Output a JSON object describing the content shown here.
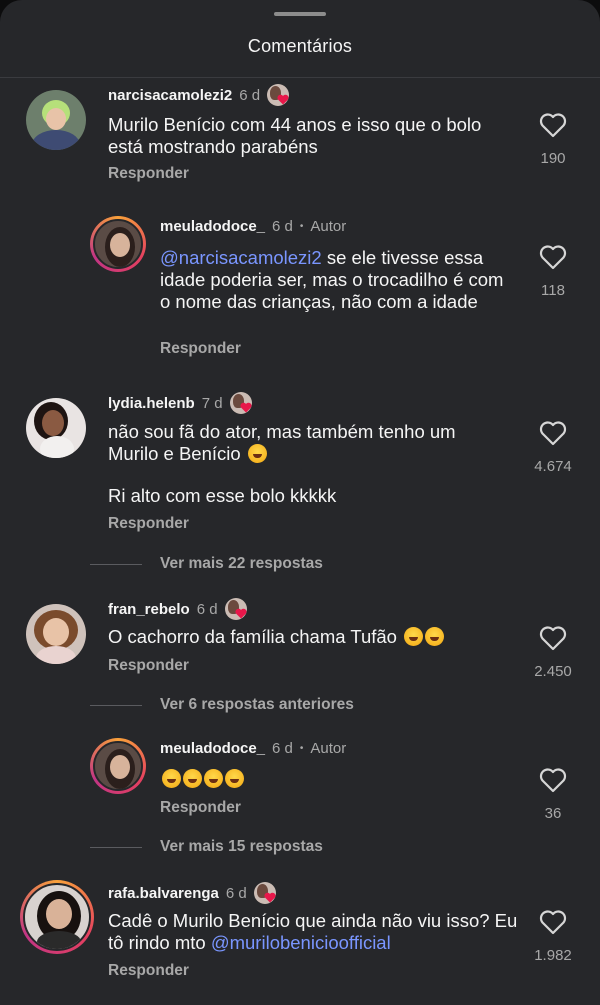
{
  "header": {
    "title": "Comentários"
  },
  "icons": {
    "like": "heart-outline-icon",
    "emoji": "tears-of-joy-emoji",
    "badge": "creator-heart-badge"
  },
  "comments": [
    {
      "user": "narcisacamolezi2",
      "time": "6 d",
      "text": "Murilo Benício com 44 anos e isso que o bolo está mostrando  parabéns",
      "reply": "Responder",
      "likes": "190"
    },
    {
      "user": "meuladodoce_",
      "time": "6 d",
      "badge": "Autor",
      "mention": "@narcisacamolezi2",
      "text": " se ele tivesse essa idade poderia ser, mas o trocadilho é com o nome das crianças, não com a idade",
      "reply": "Responder",
      "likes": "118"
    },
    {
      "user": "lydia.helenb",
      "time": "7 d",
      "text1": "não sou fã do ator, mas também tenho um Murilo e Benício",
      "text2": "Ri alto com esse bolo  kkkkk",
      "reply": "Responder",
      "likes": "4.674"
    },
    {
      "user": "fran_rebelo",
      "time": "6 d",
      "text": "O cachorro da família chama Tufão",
      "reply": "Responder",
      "likes": "2.450"
    },
    {
      "user": "meuladodoce_",
      "time": "6 d",
      "badge": "Autor",
      "text": "",
      "reply": "Responder",
      "likes": "36"
    },
    {
      "user": "rafa.balvarenga",
      "time": "6 d",
      "text": "Cadê o Murilo Benício que ainda não viu isso? Eu tô rindo mto ",
      "mention": "@murilobenicioofficial",
      "reply": "Responder",
      "likes": "1.982"
    }
  ],
  "threads": {
    "more1": "Ver mais 22 respostas",
    "prev": "Ver 6 respostas anteriores",
    "more2": "Ver mais 15 respostas"
  }
}
